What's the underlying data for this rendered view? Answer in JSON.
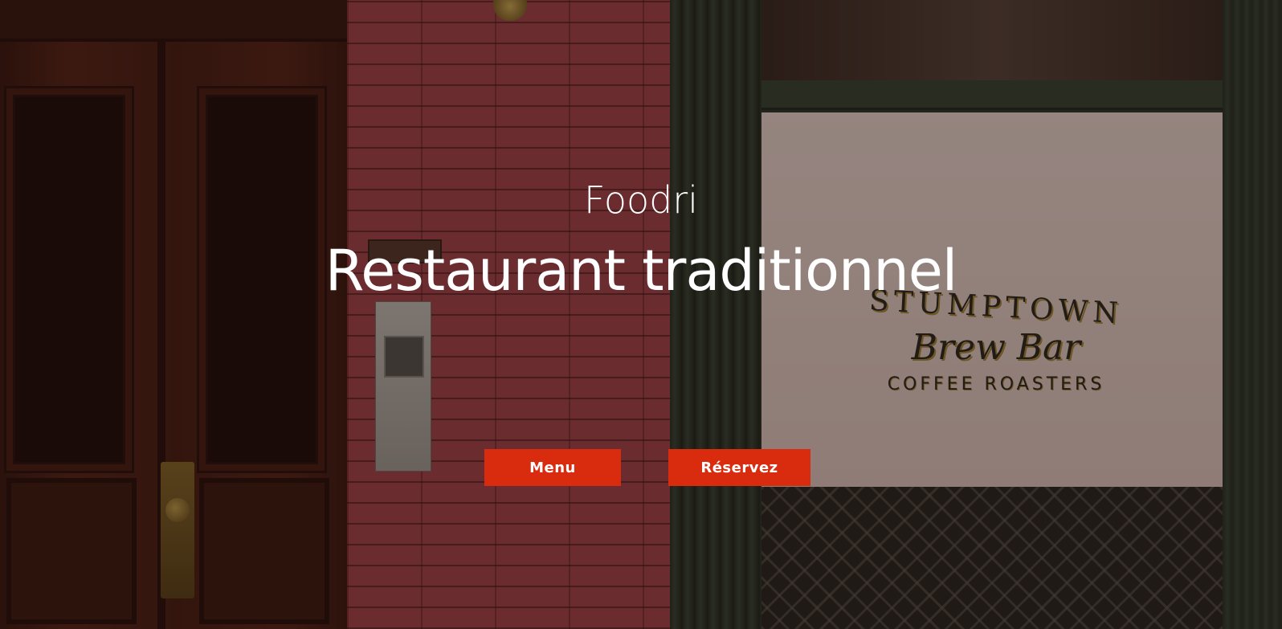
{
  "hero": {
    "brand": "Foodri",
    "headline": "Restaurant traditionnel",
    "buttons": {
      "menu_label": "Menu",
      "reserve_label": "Réservez"
    }
  },
  "background_sign": {
    "line1": "STUMPTOWN",
    "line2": "Brew Bar",
    "line3": "COFFEE ROASTERS"
  },
  "colors": {
    "accent": "#d92b0d",
    "text": "#ffffff"
  }
}
